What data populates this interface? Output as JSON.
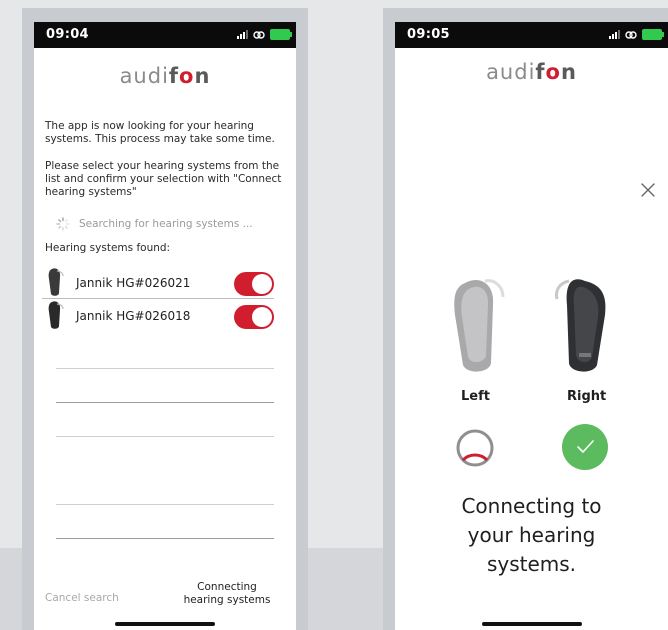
{
  "colors": {
    "accent": "#d01e2e",
    "success": "#5cbb5f",
    "battery": "#31c94e"
  },
  "left_screen": {
    "status_time": "09:04",
    "logo": {
      "part1": "audi",
      "part2": "f",
      "part3": "o",
      "part4": "n"
    },
    "intro_text": "The app is now looking for your hearing systems. This process may take some time.",
    "instruction_text": "Please select your hearing systems from the list and confirm your selection with \"Connect hearing systems\"",
    "searching_text": "Searching for hearing systems ...",
    "found_label": "Hearing systems found:",
    "devices": [
      {
        "name": "Jannik HG#026021",
        "selected": true,
        "icon": "hearing-aid-icon"
      },
      {
        "name": "Jannik HG#026018",
        "selected": true,
        "icon": "hearing-aid-icon"
      }
    ],
    "cancel_label": "Cancel search",
    "connect_label": "Connecting\nhearing systems"
  },
  "right_screen": {
    "status_time": "09:05",
    "logo": {
      "part1": "audi",
      "part2": "f",
      "part3": "o",
      "part4": "n"
    },
    "close_icon": "close-icon",
    "left_label": "Left",
    "right_label": "Right",
    "left_status_icon": "progress-ring-icon",
    "right_status_icon": "check-icon",
    "left_progress": 0.25,
    "connecting_text": "Connecting to your hearing systems."
  }
}
